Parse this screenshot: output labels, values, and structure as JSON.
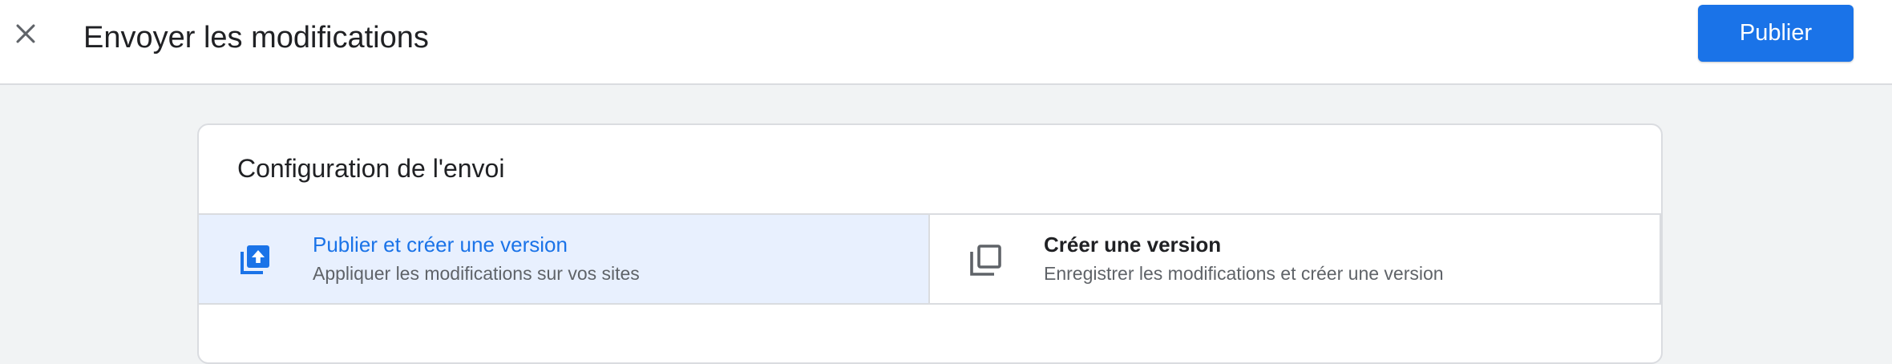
{
  "header": {
    "title": "Envoyer les modifications",
    "publish_label": "Publier",
    "close_icon": "close-icon"
  },
  "card": {
    "title": "Configuration de l'envoi",
    "options": [
      {
        "title": "Publier et créer une version",
        "subtitle": "Appliquer les modifications sur vos sites",
        "icon": "publish-version-icon",
        "selected": true
      },
      {
        "title": "Créer une version",
        "subtitle": "Enregistrer les modifications et créer une version",
        "icon": "version-icon",
        "selected": false
      }
    ]
  },
  "colors": {
    "accent": "#1a73e8",
    "selected_bg": "#e8f0fe",
    "page_bg": "#f1f3f4"
  }
}
